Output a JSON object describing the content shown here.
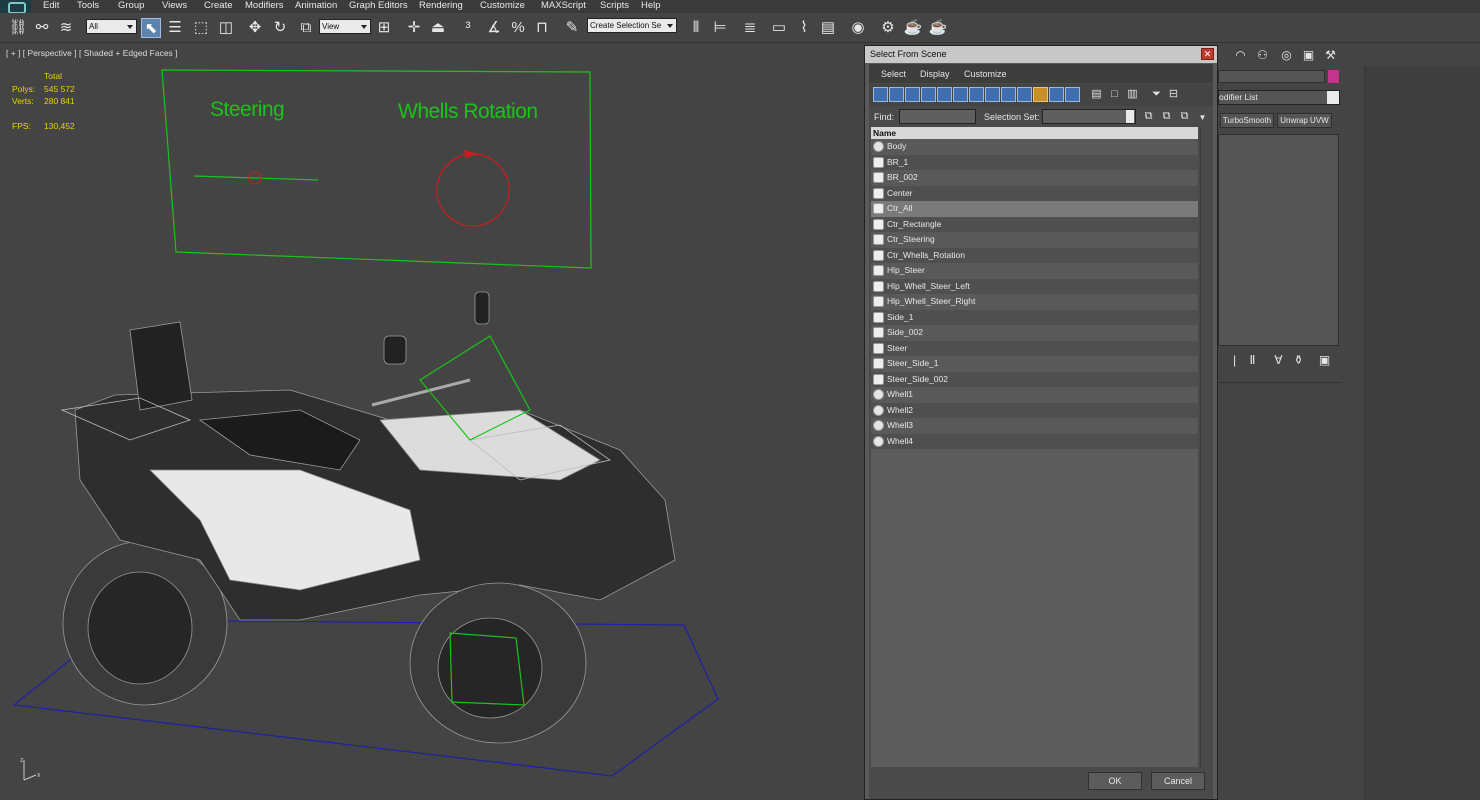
{
  "menubar": {
    "items": [
      "Edit",
      "Tools",
      "Group",
      "Views",
      "Create",
      "Modifiers",
      "Animation",
      "Graph Editors",
      "Rendering",
      "Customize",
      "MAXScript",
      "Scripts",
      "Help"
    ]
  },
  "toolbar": {
    "selection_filter": "All",
    "reference_coord": "View",
    "named_selection_placeholder": "Create Selection Se"
  },
  "viewport": {
    "label": "[ + ] [ Perspective ] [ Shaded + Edged Faces ]",
    "stats": {
      "total_label": "Total",
      "polys_label": "Polys:",
      "polys_value": "545 572",
      "verts_label": "Verts:",
      "verts_value": "280 841",
      "fps_label": "FPS:",
      "fps_value": "130,452"
    },
    "controls": {
      "steering_label": "Steering",
      "wheels_label": "Whells Rotation"
    },
    "axis": {
      "z": "z",
      "x": "x"
    },
    "colors": {
      "control": "#19c419",
      "helper": "#d11a1a",
      "ground": "#1f1fa8"
    }
  },
  "dialog": {
    "title": "Select From Scene",
    "close_label": "✕",
    "menu": [
      "Select",
      "Display",
      "Customize"
    ],
    "find_label": "Find:",
    "find_value": "",
    "selection_set_label": "Selection Set:",
    "column_header": "Name",
    "objects": [
      {
        "name": "Body",
        "kind": "geometry"
      },
      {
        "name": "BR_1",
        "kind": "helper"
      },
      {
        "name": "BR_002",
        "kind": "helper"
      },
      {
        "name": "Center",
        "kind": "helper"
      },
      {
        "name": "Ctr_All",
        "kind": "helper",
        "selected": true
      },
      {
        "name": "Ctr_Rectangle",
        "kind": "helper"
      },
      {
        "name": "Ctr_Steering",
        "kind": "helper"
      },
      {
        "name": "Ctr_Whells_Rotation",
        "kind": "helper"
      },
      {
        "name": "Hlp_Steer",
        "kind": "helper"
      },
      {
        "name": "Hlp_Whell_Steer_Left",
        "kind": "helper"
      },
      {
        "name": "Hlp_Whell_Steer_Right",
        "kind": "helper"
      },
      {
        "name": "Side_1",
        "kind": "helper"
      },
      {
        "name": "Side_002",
        "kind": "helper"
      },
      {
        "name": "Steer",
        "kind": "helper"
      },
      {
        "name": "Steer_Side_1",
        "kind": "helper"
      },
      {
        "name": "Steer_Side_002",
        "kind": "helper"
      },
      {
        "name": "Whell1",
        "kind": "geometry"
      },
      {
        "name": "Whell2",
        "kind": "geometry"
      },
      {
        "name": "Whell3",
        "kind": "geometry"
      },
      {
        "name": "Whell4",
        "kind": "geometry"
      }
    ],
    "ok_label": "OK",
    "cancel_label": "Cancel"
  },
  "command_panel": {
    "modifier_list_label": "odifier List",
    "buttons": [
      "TurboSmooth",
      "Unwrap UVW"
    ],
    "object_color": "#c6338d"
  }
}
